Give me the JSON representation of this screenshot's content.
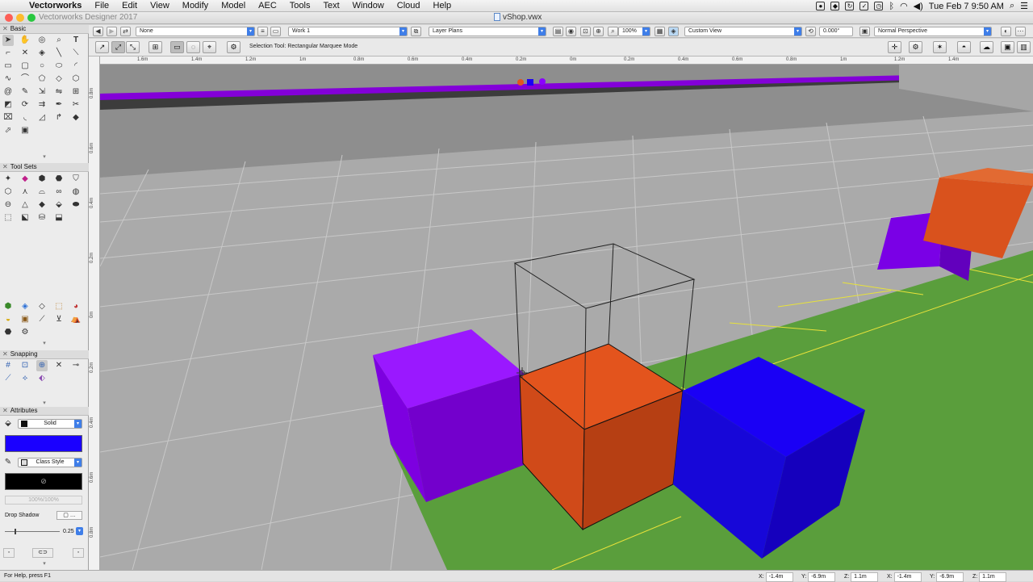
{
  "menubar": {
    "app": "Vectorworks",
    "menus": [
      "File",
      "Edit",
      "View",
      "Modify",
      "Model",
      "AEC",
      "Tools",
      "Text",
      "Window",
      "Cloud",
      "Help"
    ],
    "clock": "Tue Feb 7  9:50 AM"
  },
  "window": {
    "app_title": "Vectorworks Designer 2017",
    "doc_title": "vShop.vwx"
  },
  "viewbar": {
    "class": "None",
    "layer": "Work 1",
    "layer_mode": "Layer Plans",
    "zoom": "100%",
    "view": "Custom View",
    "angle": "0.000°",
    "projection": "Normal Perspective"
  },
  "toolbar": {
    "mode_text": "Selection Tool: Rectangular Marquee Mode"
  },
  "palettes": {
    "basic_title": "Basic",
    "toolsets_title": "Tool Sets",
    "snapping_title": "Snapping",
    "attributes_title": "Attributes"
  },
  "attributes": {
    "fill_style": "Solid",
    "fill_color": "#1a00ff",
    "pen_style": "Class Style",
    "pen_color": "#000000",
    "opacity": "100%/100%",
    "drop_shadow": "Drop Shadow",
    "line_weight": "0.25"
  },
  "rulers": {
    "top": [
      "1.6m",
      "1.4m",
      "1.2m",
      "1m",
      "0.8m",
      "0.6m",
      "0.4m",
      "0.2m",
      "0m",
      "0.2m",
      "0.4m",
      "0.6m",
      "0.8m",
      "1m",
      "1.2m",
      "1.4m"
    ],
    "left": [
      "0.8m",
      "0.6m",
      "0.4m",
      "0.2m",
      "0m",
      "0.2m",
      "0.4m",
      "0.6m",
      "0.8m"
    ]
  },
  "status": {
    "help": "For Help, press F1",
    "x": "-1.4m",
    "y": "-6.9m",
    "z": "1.1m",
    "x2": "-1.4m",
    "y2": "-6.9m",
    "z2": "1.1m"
  },
  "colors": {
    "purple_top": "#8a00ff",
    "purple_side": "#6a00c8",
    "orange_top": "#e3541d",
    "orange_side": "#b63f13",
    "blue_top": "#1a00f5",
    "blue_side": "#1500bd",
    "green": "#5a9e3c",
    "floor": "#aaaaaa"
  },
  "icons": [
    "apple-icon",
    "arrow-tool-icon",
    "pan-icon",
    "flyover-icon",
    "zoom-icon",
    "text-icon"
  ]
}
